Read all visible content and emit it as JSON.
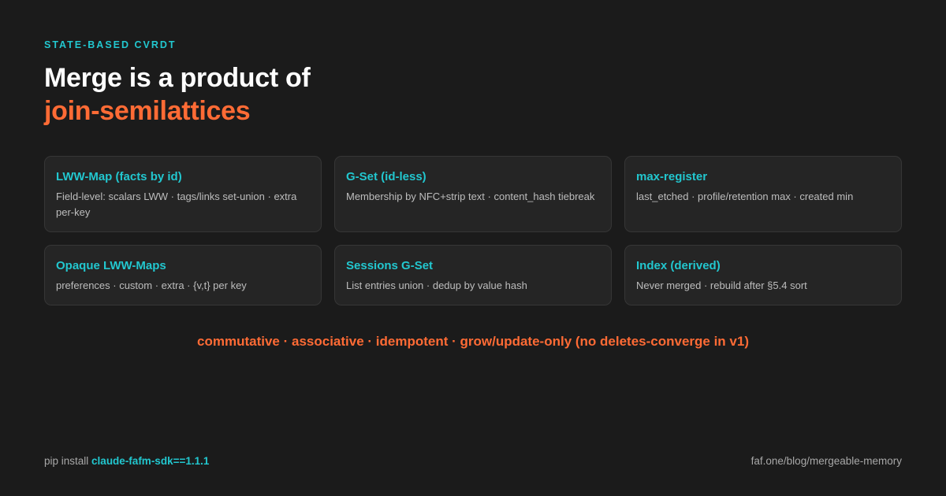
{
  "eyebrow": "STATE-BASED CVRDT",
  "title": {
    "line1": "Merge is a product of",
    "line2": "join-semilattices"
  },
  "cards": [
    {
      "title": "LWW-Map (facts by id)",
      "desc": "Field-level: scalars LWW · tags/links set-union · extra per-key"
    },
    {
      "title": "G-Set (id-less)",
      "desc": "Membership by NFC+strip text · content_hash tiebreak"
    },
    {
      "title": "max-register",
      "desc": "last_etched · profile/retention max · created min"
    },
    {
      "title": "Opaque LWW-Maps",
      "desc": "preferences · custom · extra · {v,t} per key"
    },
    {
      "title": "Sessions G-Set",
      "desc": "List entries union · dedup by value hash"
    },
    {
      "title": "Index (derived)",
      "desc": "Never merged · rebuild after §5.4 sort"
    }
  ],
  "tagline": "commutative · associative · idempotent · grow/update-only (no deletes-converge in v1)",
  "footer": {
    "install_prefix": "pip install ",
    "package": "claude-fafm-sdk==1.1.1",
    "url": "faf.one/blog/mergeable-memory"
  },
  "colors": {
    "background": "#1b1b1b",
    "accent_teal": "#22c7cf",
    "accent_orange": "#ff6b35",
    "card_bg": "#252525"
  }
}
